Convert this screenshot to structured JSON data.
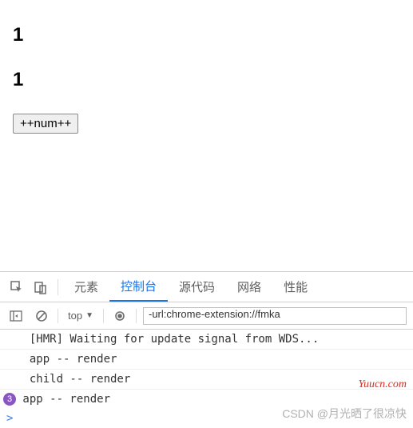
{
  "page": {
    "num1": "1",
    "num2": "1",
    "button_label": "++num++"
  },
  "devtools": {
    "tabs": {
      "elements": "元素",
      "console": "控制台",
      "sources": "源代码",
      "network": "网络",
      "performance": "性能"
    },
    "toolbar": {
      "context": "top",
      "filter_value": "-url:chrome-extension://fmka"
    },
    "logs": {
      "l0": "  [HMR] Waiting for update signal from WDS...",
      "l1": "  app -- render",
      "l2": "  child -- render",
      "l3_count": "3",
      "l3": " app -- render"
    },
    "prompt": ">"
  },
  "watermark": {
    "w1": "Yuucn.com",
    "w2": "CSDN @月光晒了很凉快"
  }
}
